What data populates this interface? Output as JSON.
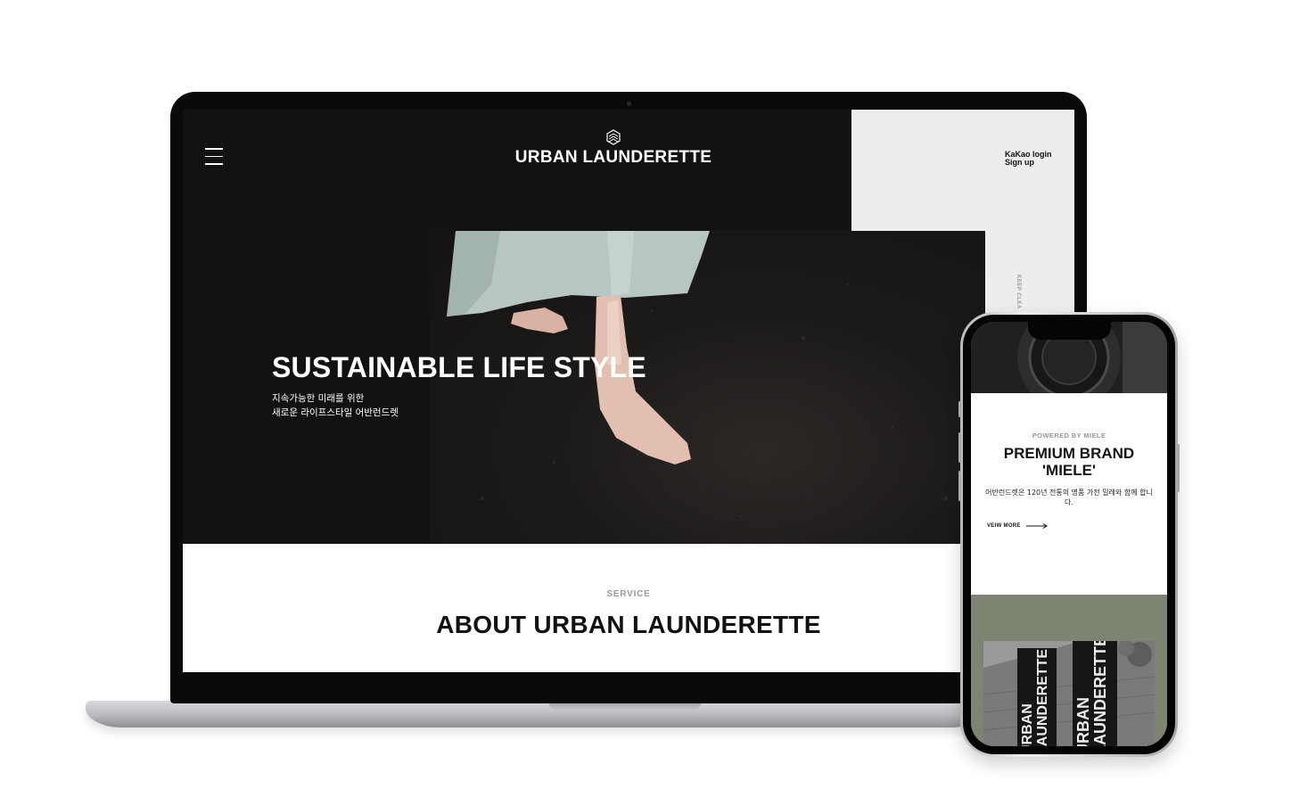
{
  "laptop": {
    "header": {
      "brand": "URBAN LAUNDERETTE",
      "kakao_login": "KaKao login",
      "sign_up": "Sign up"
    },
    "side_text": "KEEP CLEA",
    "hero": {
      "title": "SUSTAINABLE LIFE STYLE",
      "sub_line1": "지속가능한 미래를 위한",
      "sub_line2": "새로운 라이프스타일 어반런드렛"
    },
    "service": {
      "label": "SERVICE",
      "title": "ABOUT URBAN LAUNDERETTE"
    }
  },
  "phone": {
    "powered_by": "POWERED BY MIELE",
    "title_line1": "PREMIUM BRAND",
    "title_line2": "'MIELE'",
    "description": "어반런드렛은 120년 전통의 명품 가전 밀레와 함께 합니다.",
    "view_more": "VEIW MORE",
    "banner_left": "URBAN\nLAUNDERETTE",
    "banner_right": "URBAN\nLAUNDERETTE"
  },
  "colors": {
    "hero_black": "#121212",
    "hero_light": "#ededed",
    "olive": "#7d8471"
  }
}
